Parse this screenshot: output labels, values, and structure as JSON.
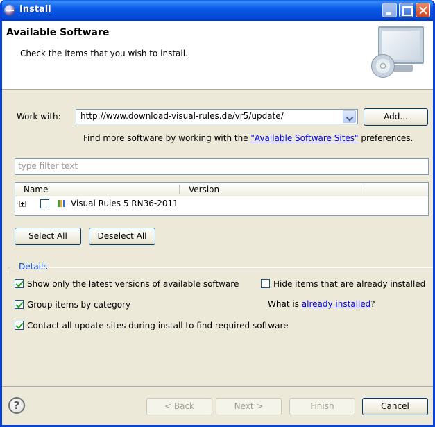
{
  "window": {
    "title": "Install"
  },
  "header": {
    "title": "Available Software",
    "subtitle": "Check the items that you wish to install."
  },
  "work_with": {
    "label": "Work with:",
    "value": "http://www.download-visual-rules.de/vr5/update/",
    "add_button": "Add..."
  },
  "more_software": {
    "prefix": "Find more software by working with the ",
    "link": "\"Available Software Sites\"",
    "suffix": " preferences."
  },
  "filter": {
    "placeholder": "type filter text"
  },
  "table": {
    "columns": [
      "Name",
      "Version"
    ],
    "rows": [
      {
        "name": "Visual Rules 5 RN36-2011",
        "version": "",
        "checked": false,
        "expanded": false
      }
    ]
  },
  "selection_buttons": {
    "select_all": "Select All",
    "deselect_all": "Deselect All"
  },
  "details": {
    "legend": "Details",
    "show_latest": {
      "label": "Show only the latest versions of available software",
      "checked": true
    },
    "hide_installed": {
      "label": "Hide items that are already installed",
      "checked": false
    },
    "group_by_category": {
      "label": "Group items by category",
      "checked": true
    },
    "what_is": {
      "prefix": "What is ",
      "link": "already installed",
      "suffix": "?"
    },
    "contact_sites": {
      "label": "Contact all update sites during install to find required software",
      "checked": true
    }
  },
  "footer": {
    "help_glyph": "?",
    "back": "< Back",
    "next": "Next >",
    "finish": "Finish",
    "cancel": "Cancel"
  },
  "icons": {
    "title_icon": "eclipse-install-icon",
    "banner_icon": "monitor-cd-icon",
    "feature_icon": "feature-bars-icon",
    "help_icon": "help-circle-icon"
  },
  "colors": {
    "title_bar": "#0a5be8",
    "dialog_bg": "#ece9d8",
    "link": "#0000ee",
    "check": "#21a121"
  }
}
